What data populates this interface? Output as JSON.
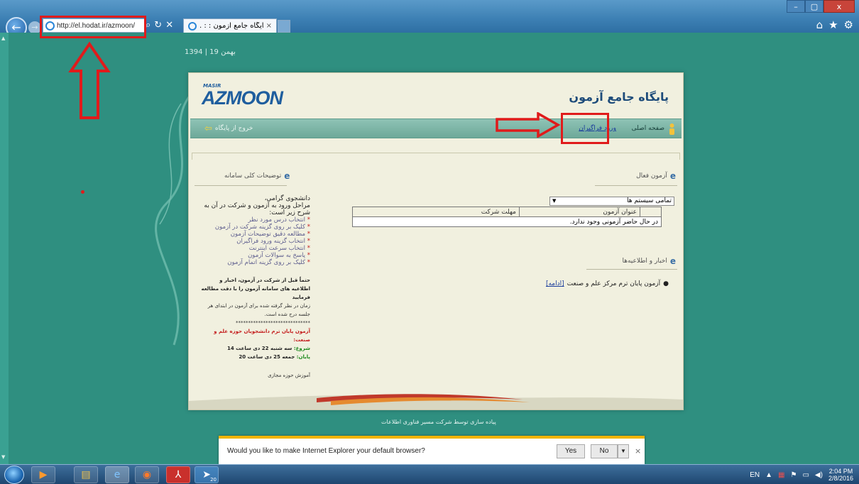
{
  "browser": {
    "address_url": "http://el.hodat.ir/azmoon/",
    "tab_title": ". : : پایگاه جامع آزمون : : .",
    "tab_close": "×",
    "win_min": "–",
    "win_max": "▢",
    "win_close": "x"
  },
  "page": {
    "date": "1394 | 19 بهمن",
    "logo_small": "MASIR",
    "logo_text": "AZMOON",
    "site_title": "پایگاه جامع آزمون",
    "nav": {
      "home": "صفحه اصلی",
      "login": "ورود فراگیران",
      "exit": "خروج از پایگاه"
    },
    "active_exams": {
      "title": "آزمون فعال",
      "select_value": "تمامی سیستم ها",
      "columns": [
        "عنوان آزمون",
        "مهلت شرکت"
      ],
      "empty_message": "در حال حاضر آزمونی وجود ندارد."
    },
    "news": {
      "title": "اخبار و اطلاعیه‌ها",
      "item": "آزمون پایان ترم مرکز علم و صنعت",
      "more": "[ادامه]"
    },
    "description": {
      "title": "توضیحات کلی سامانه",
      "greeting": "دانشجوی گرامی،",
      "intro": "مراحل ورود به آزمون و شرکت در آن به شرح زیر است:",
      "steps": [
        "انتخاب درس مورد نظر",
        "کلیک بر روی گزینه شرکت در آزمون",
        "مطالعه دقیق توضیحات آزمون",
        "انتخاب گزینه ورود فراگیران",
        "انتخاب سرعت اینترنت",
        "پاسخ به سوالات آزمون",
        "کلیک بر روی گزینه اتمام آزمون"
      ],
      "note_line1": "حتماً قبل از شرکت در آزمون، اخبار و اطلاعیه های سامانه آزمون را با دقت مطالعه فرمایید",
      "note_line2": "زمان در نظر گرفته شده برای آزمون در ابتدای هر جلسه درج شده است.",
      "separator": "******************************",
      "exam_title": "آزمون پایان ترم دانشجویان حوزه علم و صنعت:",
      "start_label": "شروع:",
      "start_value": "سه شنبه 22 دی ساعت 14",
      "end_label": "پایان:",
      "end_value": "جمعه 25 دی ساعت 20",
      "unit": "آموزش حوزه مجازی"
    },
    "credit": "پیاده سازی توسط شرکت مسیر فناوری اطلاعات"
  },
  "notification": {
    "message": "Would you like to make Internet Explorer your default browser?",
    "yes": "Yes",
    "no": "No",
    "close": "×"
  },
  "taskbar": {
    "lang": "EN",
    "time": "2:04 PM",
    "date": "2/8/2016",
    "badge": "20"
  },
  "colors": {
    "page_bg": "#2f8f80",
    "annotation_red": "#e01b1b",
    "nav_bar": "#8ec3b5",
    "link_blue": "#1a3c9c"
  }
}
